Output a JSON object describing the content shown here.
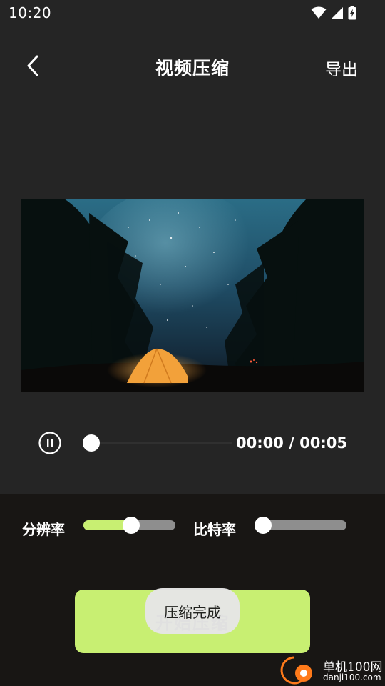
{
  "status_bar": {
    "time": "10:20",
    "icons": [
      "wifi-icon",
      "cellular-signal-icon",
      "battery-charging-icon"
    ]
  },
  "header": {
    "back_icon": "chevron-left-icon",
    "title": "视频压缩",
    "export_label": "导出"
  },
  "player": {
    "pause_icon": "pause-circle-icon",
    "time_readout": "00:00 / 00:05",
    "progress": 0.0
  },
  "settings": {
    "resolution_label": "分辨率",
    "resolution_value": 0.52,
    "bitrate_label": "比特率",
    "bitrate_value": 0.0
  },
  "start_button_label": "开始压缩",
  "toast_text": "压缩完成",
  "watermark": {
    "name": "单机100网",
    "url": "danji100.com"
  },
  "colors": {
    "accent": "#c8ef72",
    "background": "#252525",
    "panel": "#181614",
    "slider_track": "#8e8e8e",
    "toast": "#e6e6e6"
  }
}
